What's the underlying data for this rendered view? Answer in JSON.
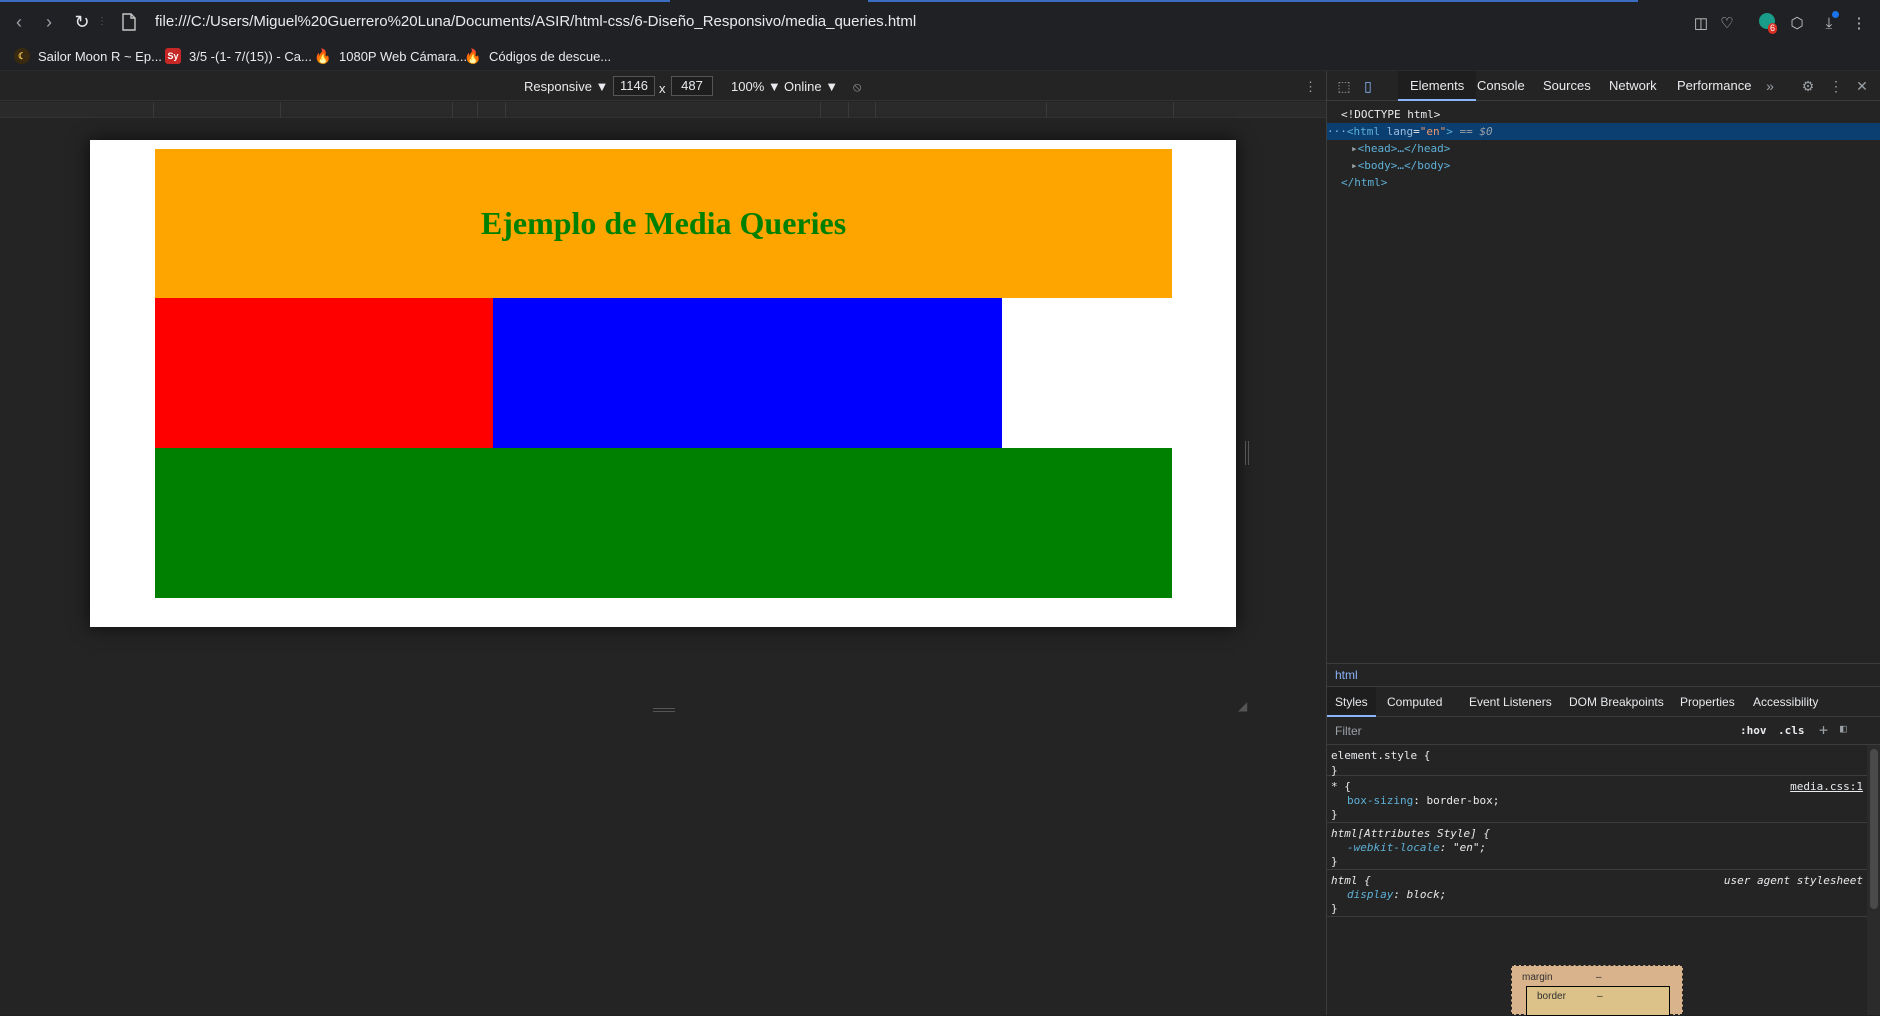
{
  "browser": {
    "url": "file:///C:/Users/Miguel%20Guerrero%20Luna/Documents/ASIR/html-css/6-Diseño_Responsivo/media_queries.html",
    "extensions_badge": "6",
    "bookmarks": [
      {
        "label": "Sailor Moon R ~ Ep...",
        "icon": "crescent-icon"
      },
      {
        "label": "3/5 -(1- 7/(15)) - Ca...",
        "icon": "sy-icon",
        "icon_text": "Sy"
      },
      {
        "label": "1080P Web Cámara...",
        "icon": "flame-icon"
      },
      {
        "label": "Códigos de descue...",
        "icon": "flame-icon"
      }
    ]
  },
  "device_toolbar": {
    "mode": "Responsive ▼",
    "width": "1146",
    "times": "x",
    "height": "487",
    "zoom": "100% ▼",
    "network": "Online ▼"
  },
  "page": {
    "heading": "Ejemplo de Media Queries",
    "colors": {
      "header": "#ffa500",
      "heading": "#008000",
      "red": "#ff0000",
      "blue": "#0000ff",
      "green": "#008000"
    }
  },
  "devtools": {
    "tabs": [
      "Elements",
      "Console",
      "Sources",
      "Network",
      "Performance"
    ],
    "more": "»",
    "dom": {
      "doctype": "<!DOCTYPE html>",
      "html_open_prefix": "···",
      "html_tag": "<html",
      "html_attr_name": "lang",
      "html_attr_value": "\"en\"",
      "html_close_bracket": ">",
      "dollar": " == $0",
      "head": "<head>…</head>",
      "body": "<body>…</body>",
      "html_close": "</html>"
    },
    "breadcrumb": "html",
    "sub_tabs": [
      "Styles",
      "Computed",
      "Event Listeners",
      "DOM Breakpoints",
      "Properties",
      "Accessibility"
    ],
    "filter_placeholder": "Filter",
    "hov": ":hov",
    "cls": ".cls",
    "rules": {
      "r1_selector": "element.style {",
      "r1_close": "}",
      "r2_selector": "* {",
      "r2_source": "media.css:1",
      "r2_prop": "box-sizing",
      "r2_value": "border-box;",
      "r2_close": "}",
      "r3_selector": "html[Attributes Style] {",
      "r3_prop": "-webkit-locale",
      "r3_value": "\"en\";",
      "r3_close": "}",
      "r4_selector": "html {",
      "r4_source": "user agent stylesheet",
      "r4_prop": "display",
      "r4_value": "block;",
      "r4_close": "}"
    },
    "box_model": {
      "margin": "margin",
      "margin_val": "–",
      "border": "border",
      "border_val": "–"
    }
  }
}
